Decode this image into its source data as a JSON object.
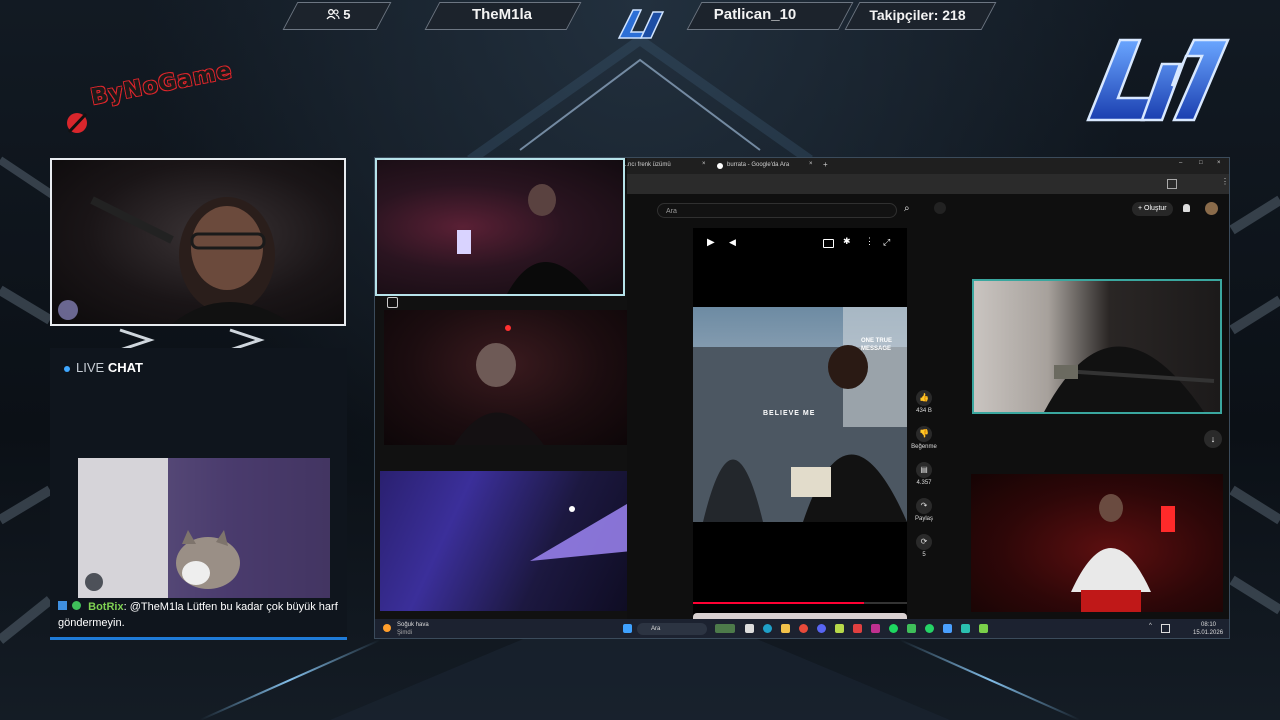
{
  "top_bar": {
    "viewers_icon": "users-icon",
    "viewers": "5",
    "left_name": "TheM1la",
    "right_name": "Patlican_10",
    "followers": "Takipçiler: 218"
  },
  "sponsor_logo": "ByNoGame",
  "chat": {
    "live_label": "LIVE",
    "chat_label": "CHAT",
    "message_user": "BotRix",
    "message_text": ": @TheM1la Lütfen bu kadar çok büyük harf göndermeyin."
  },
  "browser": {
    "tab1": "...ncı frenk üzümü",
    "tab2": "burrata - Google'da Ara",
    "search_placeholder": "Ara",
    "create_label": "Oluştur",
    "video_caption": "BELIEVE ME",
    "video_overlay": "ONE TRUE MESSAGE",
    "likes": "434 B",
    "dislike_label": "Beğenme",
    "comments": "4.357",
    "share_label": "Paylaş",
    "remix_count": "5"
  },
  "taskbar": {
    "weather_title": "Soğuk hava",
    "weather_sub": "Şimdi",
    "search_label": "Ara",
    "time": "08:10",
    "date": "15.01.2026"
  },
  "colors": {
    "chat_accent": "#1f7bd8",
    "user_green": "#7fd152",
    "frame": "#e8ecf0"
  }
}
